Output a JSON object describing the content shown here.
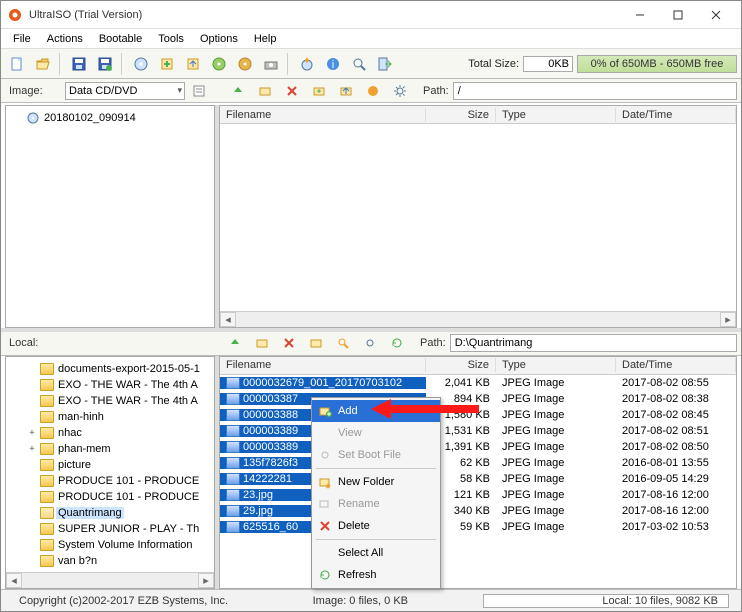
{
  "window": {
    "title": "UltraISO (Trial Version)"
  },
  "menus": [
    "File",
    "Actions",
    "Bootable",
    "Tools",
    "Options",
    "Help"
  ],
  "toolbar_icons": [
    "new-file-icon",
    "open-file-icon",
    "save-icon",
    "save-all-icon",
    "sep",
    "disc-icon",
    "disc-red-icon",
    "disc-info-icon",
    "extract-icon",
    "checksum-icon",
    "burn-icon",
    "sep",
    "help-icon",
    "info-icon",
    "about-icon",
    "exit-icon"
  ],
  "total": {
    "label": "Total Size:",
    "value": "0KB",
    "bar": "0% of 650MB - 650MB free"
  },
  "image_bar": {
    "label": "Image:",
    "combo": "Data CD/DVD",
    "path_label": "Path:",
    "path": "/"
  },
  "image_tree": {
    "root": "20180102_090914"
  },
  "upper_cols": {
    "name": "Filename",
    "size": "Size",
    "type": "Type",
    "date": "Date/Time"
  },
  "local_bar": {
    "label": "Local:",
    "path_label": "Path:",
    "path": "D:\\Quantrimang"
  },
  "local_tree": [
    {
      "name": "documents-export-2015-05-1",
      "tw": "",
      "depth": 1
    },
    {
      "name": "EXO - THE WAR - The 4th A",
      "tw": "",
      "depth": 1
    },
    {
      "name": "EXO - THE WAR - The 4th A",
      "tw": "",
      "depth": 1
    },
    {
      "name": "man-hinh",
      "tw": "",
      "depth": 1
    },
    {
      "name": "nhac",
      "tw": "+",
      "depth": 1
    },
    {
      "name": "phan-mem",
      "tw": "+",
      "depth": 1
    },
    {
      "name": "picture",
      "tw": "",
      "depth": 1
    },
    {
      "name": "PRODUCE 101 - PRODUCE",
      "tw": "",
      "depth": 1
    },
    {
      "name": "PRODUCE 101 - PRODUCE",
      "tw": "",
      "depth": 1
    },
    {
      "name": "Quantrimang",
      "tw": "",
      "depth": 1,
      "open": true,
      "sel": true
    },
    {
      "name": "SUPER JUNIOR - PLAY - Th",
      "tw": "",
      "depth": 1
    },
    {
      "name": "System Volume Information",
      "tw": "",
      "depth": 1
    },
    {
      "name": "van b?n",
      "tw": "",
      "depth": 1
    }
  ],
  "files": [
    {
      "name": "0000032679_001_20170703102",
      "size": "2,041 KB",
      "type": "JPEG Image",
      "date": "2017-08-02 08:55",
      "sel": true
    },
    {
      "name": "000003387",
      "size": "894 KB",
      "type": "JPEG Image",
      "date": "2017-08-02 08:38",
      "sel": true
    },
    {
      "name": "000003388",
      "size": "1,580 KB",
      "type": "JPEG Image",
      "date": "2017-08-02 08:45",
      "sel": true
    },
    {
      "name": "000003389",
      "size": "1,531 KB",
      "type": "JPEG Image",
      "date": "2017-08-02 08:51",
      "sel": true
    },
    {
      "name": "000003389",
      "size": "1,391 KB",
      "type": "JPEG Image",
      "date": "2017-08-02 08:50",
      "sel": true
    },
    {
      "name": "135f7826f3",
      "size": "62 KB",
      "type": "JPEG Image",
      "date": "2016-08-01 13:55",
      "sel": true
    },
    {
      "name": "14222281",
      "size": "58 KB",
      "type": "JPEG Image",
      "date": "2016-09-05 14:29",
      "sel": true
    },
    {
      "name": "23.jpg",
      "size": "121 KB",
      "type": "JPEG Image",
      "date": "2017-08-16 12:00",
      "sel": true
    },
    {
      "name": "29.jpg",
      "size": "340 KB",
      "type": "JPEG Image",
      "date": "2017-08-16 12:00",
      "sel": true
    },
    {
      "name": "625516_60",
      "size": "59 KB",
      "type": "JPEG Image",
      "date": "2017-03-02 10:53",
      "sel": true
    }
  ],
  "ctx": {
    "add": "Add",
    "view": "View",
    "setboot": "Set Boot File",
    "newfolder": "New Folder",
    "rename": "Rename",
    "delete": "Delete",
    "selectall": "Select All",
    "refresh": "Refresh"
  },
  "status": {
    "left": "Copyright (c)2002-2017 EZB Systems, Inc.",
    "mid": "Image: 0 files, 0 KB",
    "right": "Local: 10 files, 9082 KB"
  }
}
